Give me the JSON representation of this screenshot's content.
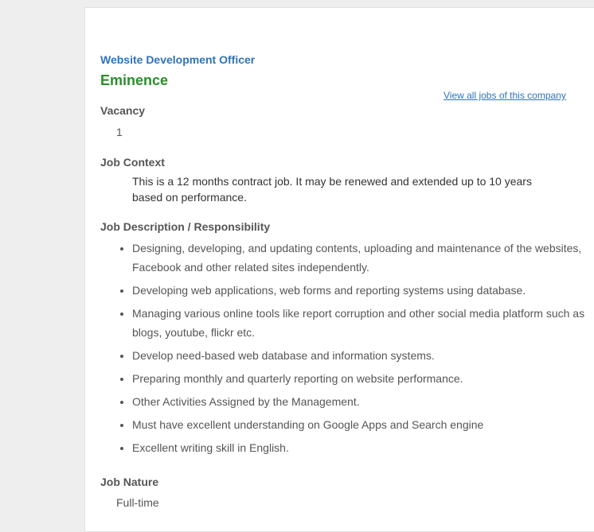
{
  "job": {
    "title": "Website Development Officer",
    "company": "Eminence",
    "view_all_link": "View all jobs of this company"
  },
  "vacancy": {
    "heading": "Vacancy",
    "value": "1"
  },
  "job_context": {
    "heading": "Job Context",
    "text": "This is a 12 months contract job. It may be renewed and extended up to 10 years based on performance."
  },
  "responsibilities": {
    "heading": "Job Description / Responsibility",
    "items": [
      "Designing, developing, and updating contents, uploading and maintenance of the websites, Facebook and other related sites independently.",
      "Developing web applications, web forms and reporting systems using database.",
      "Managing various online tools like report corruption and other social media platform such as blogs, youtube, flickr etc.",
      "Develop need-based web database and information systems.",
      "Preparing monthly and quarterly reporting on website performance.",
      "Other Activities Assigned by the Management.",
      "Must have excellent understanding on Google Apps and Search engine",
      "Excellent writing skill in English."
    ]
  },
  "job_nature": {
    "heading": "Job Nature",
    "value": "Full-time"
  },
  "colors": {
    "title_blue": "#2e73b8",
    "company_green": "#2a8f2a",
    "heading_gray": "#555555"
  }
}
